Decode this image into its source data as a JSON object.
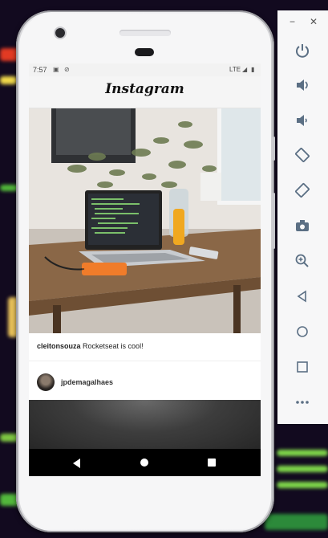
{
  "status_bar": {
    "time": "7:57",
    "network": "LTE"
  },
  "app": {
    "title": "Instagram"
  },
  "feed": {
    "posts": [
      {
        "author": "cleitonsouza",
        "description": "Rocketseat is cool!"
      },
      {
        "author": "jpdemagalhaes"
      }
    ]
  },
  "emulator_toolbar": {
    "window_controls": [
      "−",
      "✕"
    ],
    "buttons": [
      "power-icon",
      "volume-up-icon",
      "volume-down-icon",
      "rotate-left-icon",
      "rotate-right-icon",
      "camera-icon",
      "zoom-icon",
      "back-icon",
      "home-icon",
      "overview-icon",
      "more-icon"
    ]
  },
  "colors": {
    "toolbar_icon": "#5b6f84",
    "navbar": "#000000"
  }
}
